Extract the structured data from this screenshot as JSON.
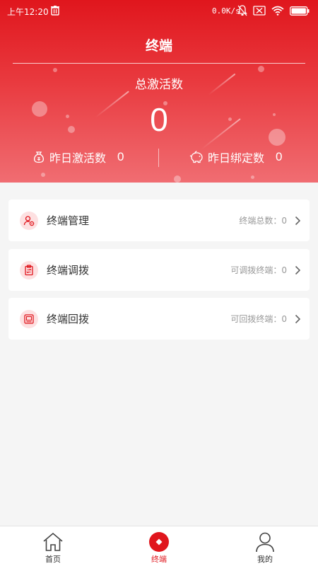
{
  "status_bar": {
    "time": "上午12:20",
    "net_speed": "0.0K/s"
  },
  "header": {
    "title": "终端",
    "total_label": "总激活数",
    "total_value": "0",
    "yesterday_activations_label": "昨日激活数",
    "yesterday_activations_value": "0",
    "yesterday_bindings_label": "昨日绑定数",
    "yesterday_bindings_value": "0"
  },
  "menu": [
    {
      "title": "终端管理",
      "meta": "终端总数：0",
      "icon": "user-gear-icon"
    },
    {
      "title": "终端调拨",
      "meta": "可调拨终端：0",
      "icon": "clipboard-icon"
    },
    {
      "title": "终端回拨",
      "meta": "可回拨终端：0",
      "icon": "monitor-icon"
    }
  ],
  "tabbar": {
    "items": [
      {
        "label": "首页",
        "icon": "home-icon",
        "active": false
      },
      {
        "label": "终端",
        "icon": "terminal-icon",
        "active": true
      },
      {
        "label": "我的",
        "icon": "person-icon",
        "active": false
      }
    ]
  },
  "colors": {
    "accent": "#e0161d",
    "icon_bg": "#fde0e1",
    "meta_text": "#999999",
    "background": "#f5f5f5"
  }
}
